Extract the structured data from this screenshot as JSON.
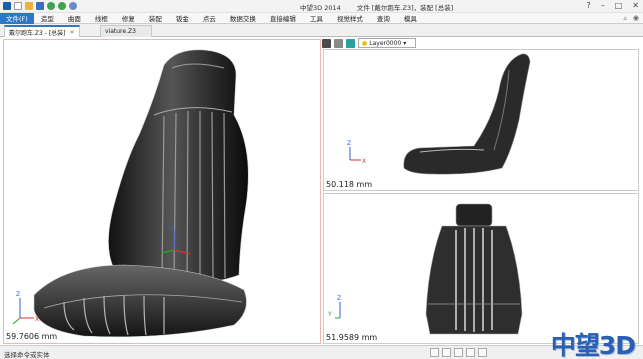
{
  "window": {
    "app_title": "中望3D 2014",
    "doc_title": "文件 [戴尔跑车.Z3]，装配 [总装]",
    "controls": [
      "?",
      "–",
      "□",
      "✕"
    ]
  },
  "menu": {
    "file_label": "文件(F)",
    "items": [
      "造型",
      "曲面",
      "线框",
      "修复",
      "装配",
      "钣金",
      "点云",
      "数据交换",
      "直接编辑",
      "工具",
      "视觉样式",
      "查询",
      "模具"
    ]
  },
  "tabs": [
    {
      "label": "戴尔跑车.Z3 - [总装]",
      "active": true
    },
    {
      "label": "viature.Z3",
      "active": false
    }
  ],
  "toolbar": {
    "layer_name": "Layer0000",
    "accent": "#2b78c6"
  },
  "viewports": {
    "main_measure": "59.7606 mm",
    "side_measure": "50.118 mm",
    "front_measure": "51.9589 mm"
  },
  "statusbar": {
    "prompt": "选择命令或实体"
  },
  "brand": {
    "logo_text": "中望3D"
  }
}
